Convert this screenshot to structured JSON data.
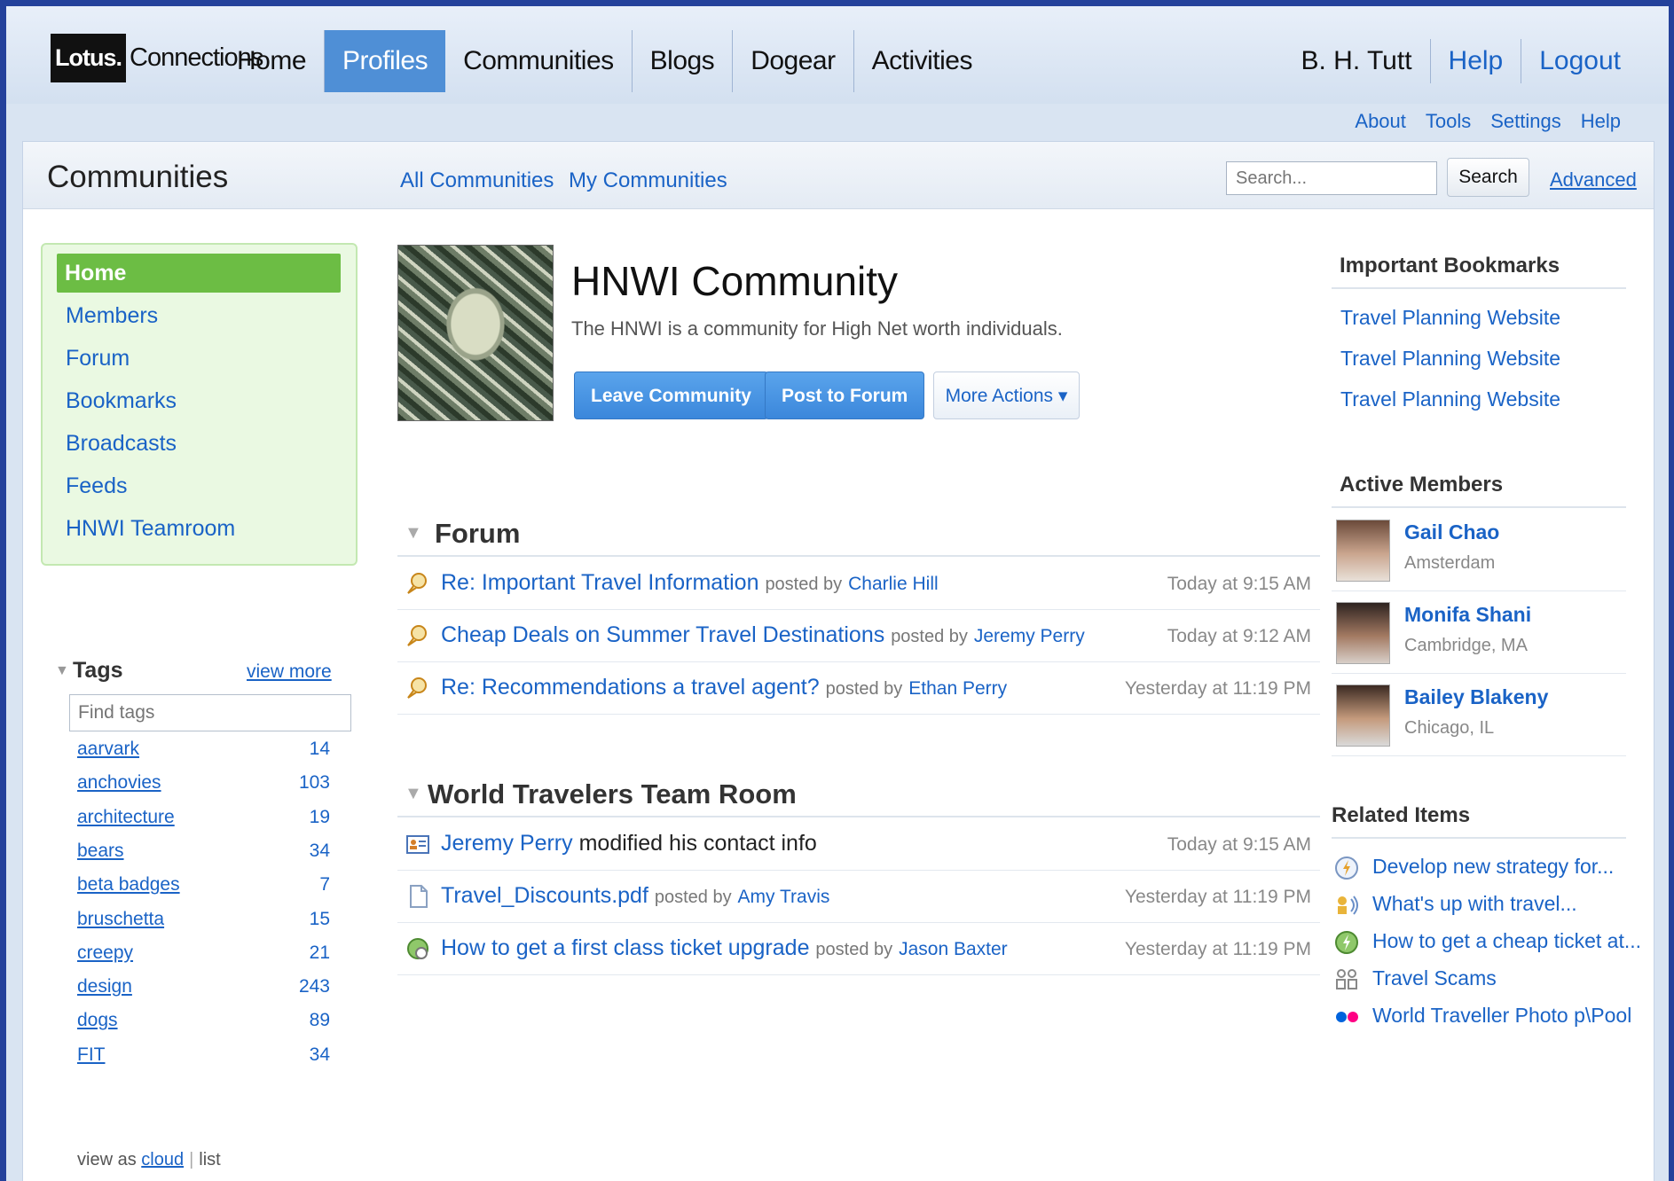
{
  "banner": {
    "logo_lotus": "Lotus.",
    "logo_connections": "Connections",
    "tabs": [
      "Home",
      "Profiles",
      "Communities",
      "Blogs",
      "Dogear",
      "Activities"
    ],
    "user": "B. H. Tutt",
    "help": "Help",
    "logout": "Logout",
    "sublinks": [
      "About",
      "Tools",
      "Settings",
      "Help"
    ]
  },
  "header": {
    "title": "Communities",
    "all_communities": "All Communities",
    "my_communities": "My Communities",
    "search_placeholder": "Search...",
    "search_button": "Search",
    "advanced": "Advanced"
  },
  "leftnav": {
    "items": [
      "Home",
      "Members",
      "Forum",
      "Bookmarks",
      "Broadcasts",
      "Feeds",
      "HNWI Teamroom"
    ]
  },
  "tags": {
    "title": "Tags",
    "view_more": "view more",
    "find_placeholder": "Find tags",
    "items": [
      {
        "name": "aarvark",
        "count": "14"
      },
      {
        "name": "anchovies",
        "count": "103"
      },
      {
        "name": "architecture",
        "count": "19"
      },
      {
        "name": "bears",
        "count": "34"
      },
      {
        "name": "beta badges",
        "count": "7"
      },
      {
        "name": "bruschetta",
        "count": "15"
      },
      {
        "name": "creepy",
        "count": "21"
      },
      {
        "name": "design",
        "count": "243"
      },
      {
        "name": "dogs",
        "count": "89"
      },
      {
        "name": "FIT",
        "count": "34"
      }
    ],
    "view_as": "view as",
    "cloud": "cloud",
    "list": "list"
  },
  "community": {
    "title": "HNWI Community",
    "description": "The HNWI is a community for High Net worth individuals.",
    "leave": "Leave Community",
    "post": "Post to Forum",
    "more": "More Actions ▾"
  },
  "forum": {
    "title": "Forum",
    "rows": [
      {
        "main": "Re: Important Travel Information",
        "by": "posted by",
        "who": "Charlie Hill",
        "time": "Today at 9:15 AM"
      },
      {
        "main": "Cheap Deals on Summer Travel Destinations",
        "by": "posted by",
        "who": "Jeremy Perry",
        "time": "Today at 9:12 AM"
      },
      {
        "main": "Re: Recommendations a travel agent?",
        "by": "posted by",
        "who": "Ethan Perry",
        "time": "Yesterday at 11:19 PM"
      }
    ]
  },
  "teamroom": {
    "title": "World Travelers Team Room",
    "rows": [
      {
        "main": "Jeremy Perry",
        "plain": "modified his contact info",
        "time": "Today at 9:15 AM"
      },
      {
        "main": "Travel_Discounts.pdf",
        "by": "posted by",
        "who": "Amy Travis",
        "time": "Yesterday at 11:19 PM"
      },
      {
        "main": "How to get a first class ticket upgrade",
        "by": "posted by",
        "who": "Jason Baxter",
        "time": "Yesterday at 11:19 PM"
      }
    ]
  },
  "bookmarks": {
    "title": "Important Bookmarks",
    "items": [
      "Travel Planning Website",
      "Travel Planning Website",
      "Travel Planning Website"
    ]
  },
  "members": {
    "title": "Active Members",
    "items": [
      {
        "name": "Gail Chao",
        "location": "Amsterdam"
      },
      {
        "name": "Monifa Shani",
        "location": "Cambridge, MA"
      },
      {
        "name": "Bailey Blakeny",
        "location": "Chicago, IL"
      }
    ]
  },
  "related": {
    "title": "Related Items",
    "items": [
      {
        "icon": "activity-icon",
        "label": "Develop new strategy for..."
      },
      {
        "icon": "forum-people-icon",
        "label": "What's up with travel..."
      },
      {
        "icon": "globe-icon",
        "label": "How to get a cheap ticket at..."
      },
      {
        "icon": "community-icon",
        "label": "Travel Scams"
      },
      {
        "icon": "flickr-icon",
        "label": "World Traveller Photo p\\Pool"
      }
    ]
  },
  "colors": {
    "accent_blue": "#1a63c6",
    "nav_green": "#6cbd44",
    "active_tab": "#4f8fd6",
    "outer_frame": "#24419b"
  }
}
